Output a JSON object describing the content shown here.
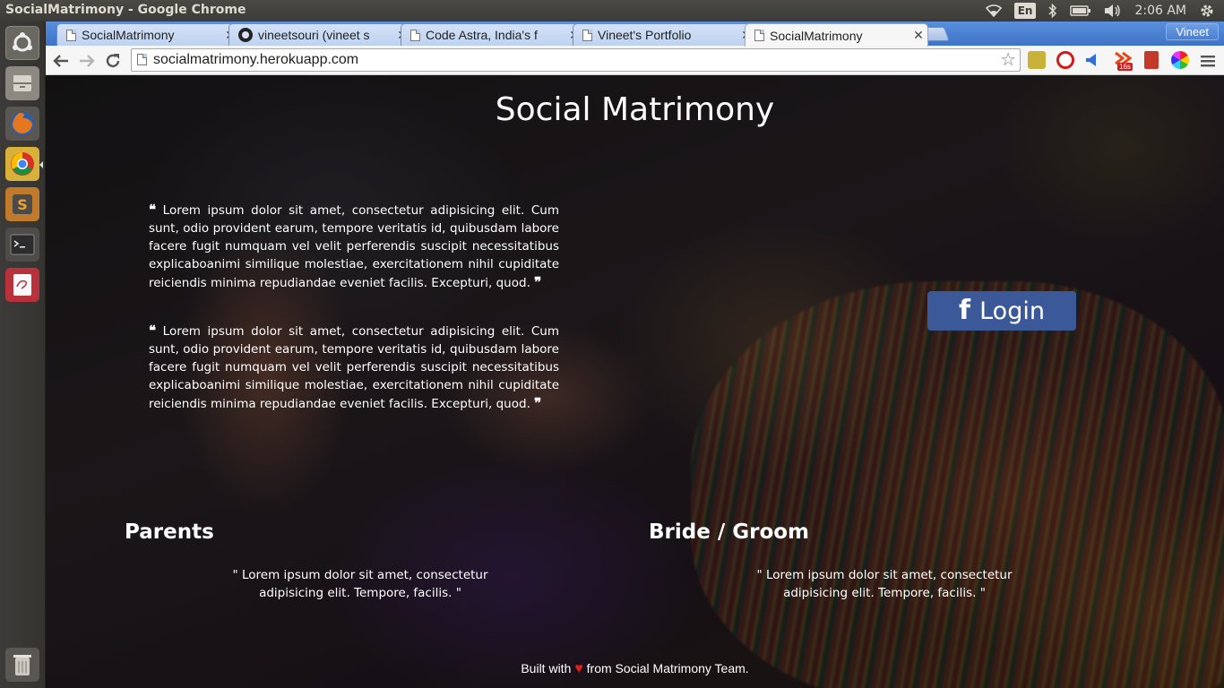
{
  "os": {
    "window_title": "SocialMatrimony - Google Chrome",
    "keyboard_layout": "En",
    "clock": "2:06 AM"
  },
  "launcher": {
    "items": [
      {
        "name": "dash-home-icon",
        "color": "#8a8780"
      },
      {
        "name": "files-icon",
        "color": "#a09a90"
      },
      {
        "name": "firefox-icon",
        "color": "#e4771f"
      },
      {
        "name": "chrome-icon",
        "color": "#d8b13a"
      },
      {
        "name": "sublime-text-icon",
        "color": "#c07a2b"
      },
      {
        "name": "terminal-icon",
        "color": "#3a3a3a"
      },
      {
        "name": "text-editor-icon",
        "color": "#b8323b"
      }
    ],
    "trash": {
      "name": "trash-icon",
      "color": "#777777"
    }
  },
  "browser": {
    "tabs": [
      {
        "title": "SocialMatrimony",
        "icon": "page-icon",
        "active": false
      },
      {
        "title": "vineetsouri (vineet s",
        "icon": "github-icon",
        "active": false
      },
      {
        "title": "Code Astra, India's f",
        "icon": "page-icon",
        "active": false
      },
      {
        "title": "Vineet's Portfolio",
        "icon": "page-icon",
        "active": false
      },
      {
        "title": "SocialMatrimony",
        "icon": "page-icon",
        "active": true
      }
    ],
    "profile_name": "Vineet",
    "url": "socialmatrimony.herokuapp.com",
    "extensions": [
      {
        "name": "extension-notes-icon",
        "color": "#c9b23a"
      },
      {
        "name": "extension-adblock-icon",
        "color": "#d01c1c"
      },
      {
        "name": "extension-megaphone-icon",
        "color": "#2f6fd6"
      },
      {
        "name": "extension-badge-icon",
        "color": "#e04a1a",
        "badge": "16s"
      },
      {
        "name": "extension-bookmark-icon",
        "color": "#c43a2a"
      },
      {
        "name": "extension-colorwheel-icon",
        "color": "#5aa03a"
      }
    ]
  },
  "page": {
    "title": "Social Matrimony",
    "quotes": [
      "Lorem ipsum dolor sit amet, consectetur adipisicing elit. Cum sunt, odio provident earum, tempore veritatis id, quibusdam labore facere fugit numquam vel velit perferendis suscipit necessitatibus explicaboanimi similique molestiae, exercitationem nihil cupiditate reiciendis minima repudiandae eveniet facilis. Excepturi, quod.",
      "Lorem ipsum dolor sit amet, consectetur adipisicing elit. Cum sunt, odio provident earum, tempore veritatis id, quibusdam labore facere fugit numquam vel velit perferendis suscipit necessitatibus explicaboanimi similique molestiae, exercitationem nihil cupiditate reiciendis minima repudiandae eveniet facilis. Excepturi, quod."
    ],
    "login_label": "Login",
    "facebook_color": "#3b5998",
    "sections": [
      {
        "heading": "Parents",
        "text": "\" Lorem ipsum dolor sit amet, consectetur adipisicing elit. Tempore, facilis. \""
      },
      {
        "heading": "Bride / Groom",
        "text": "\" Lorem ipsum dolor sit amet, consectetur adipisicing elit. Tempore, facilis. \""
      }
    ],
    "footer_before": "Built with",
    "footer_after": "from Social Matrimony Team."
  }
}
